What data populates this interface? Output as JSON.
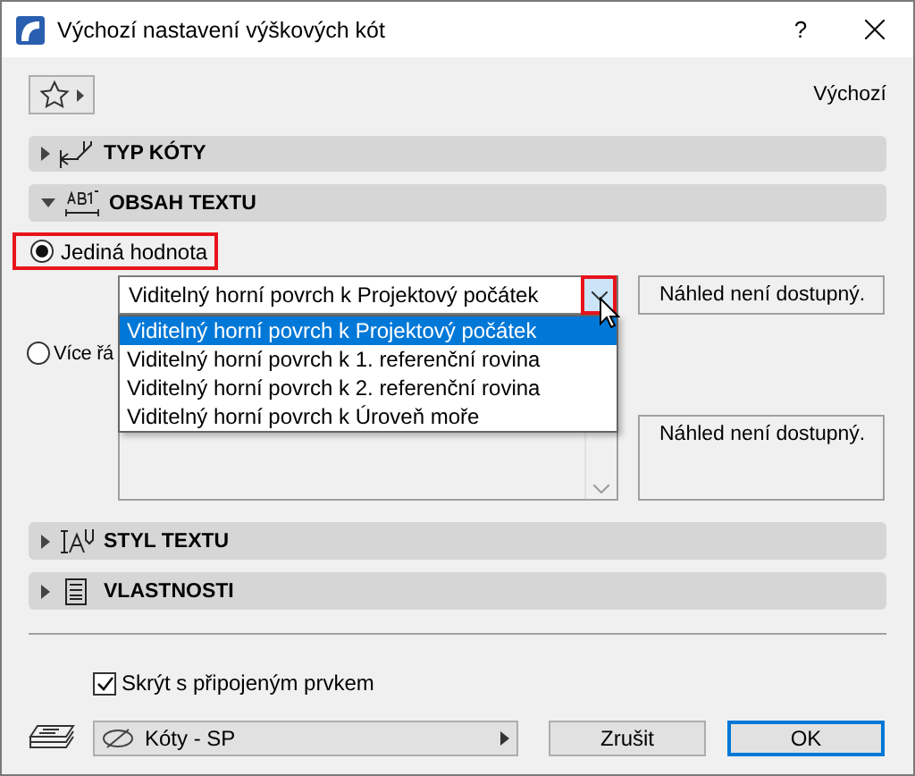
{
  "window": {
    "title": "Výchozí nastavení výškových kót",
    "help": "?"
  },
  "favorites": {
    "label": "Výchozí"
  },
  "panels_top": [
    {
      "title": "TYP KÓTY",
      "expanded": false,
      "kind": "dimension"
    },
    {
      "title": "OBSAH TEXTU",
      "expanded": true,
      "kind": "text"
    }
  ],
  "content": {
    "options": [
      {
        "label": "Jediná hodnota",
        "selected": true,
        "highlighted": true
      },
      {
        "label": "Více řá",
        "selected": false,
        "highlighted": false
      }
    ],
    "dropdown": {
      "value": "Viditelný horní povrch k Projektový počátek",
      "open": true,
      "arrow_highlighted": true,
      "items": [
        {
          "label": "Viditelný horní povrch k Projektový počátek",
          "selected": true
        },
        {
          "label": "Viditelný horní povrch k 1. referenční rovina",
          "selected": false
        },
        {
          "label": "Viditelný horní povrch k 2. referenční rovina",
          "selected": false
        },
        {
          "label": "Viditelný horní povrch k Úroveň moře",
          "selected": false
        }
      ]
    },
    "previews": [
      "Náhled není dostupný.",
      "Náhled není dostupný."
    ]
  },
  "panels_bottom": [
    {
      "title": "STYL TEXTU",
      "expanded": false,
      "kind": "style"
    },
    {
      "title": "VLASTNOSTI",
      "expanded": false,
      "kind": "properties"
    }
  ],
  "hide_with_element": {
    "label": "Skrýt s připojeným prvkem",
    "checked": true
  },
  "layer": {
    "value": "Kóty - SP"
  },
  "buttons": [
    {
      "label": "Zrušit",
      "default": false
    },
    {
      "label": "OK",
      "default": true
    }
  ]
}
